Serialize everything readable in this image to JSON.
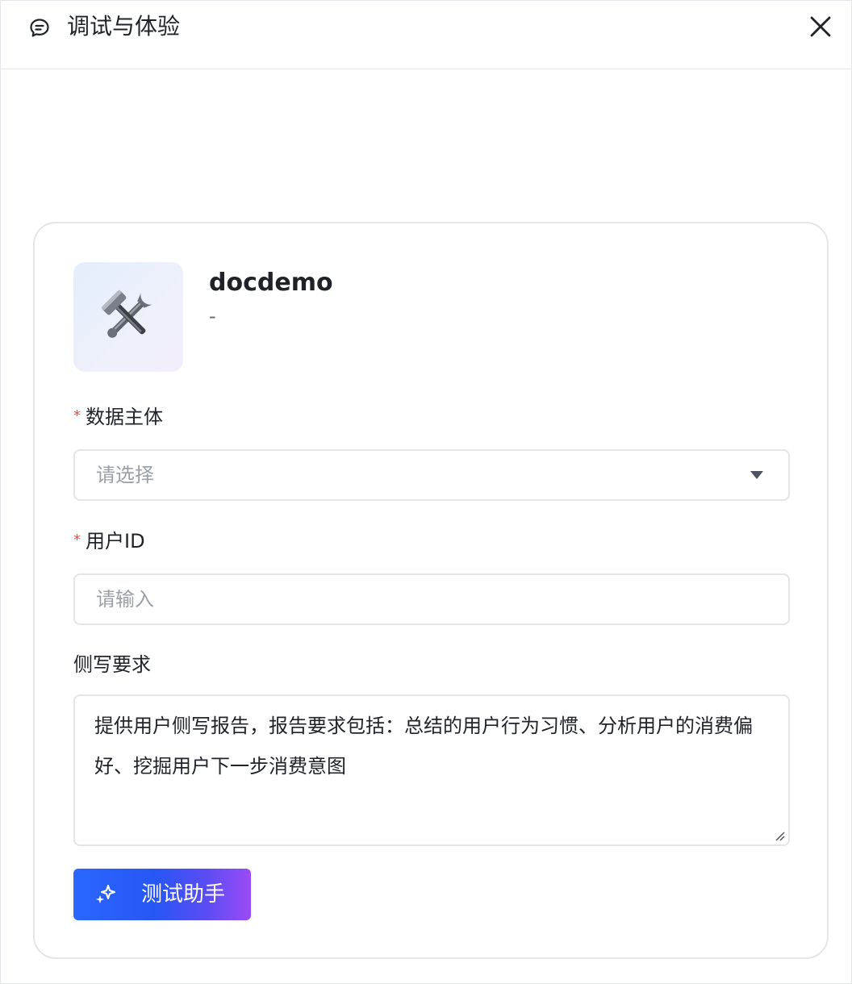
{
  "header": {
    "title": "调试与体验",
    "icon": "chat-bubble-icon",
    "close_icon": "close-icon"
  },
  "app": {
    "name": "docdemo",
    "description": "-",
    "avatar_icon": "hammer-wrench-icon"
  },
  "form": {
    "subject": {
      "label": "数据主体",
      "required_mark": "*",
      "placeholder": "请选择"
    },
    "user_id": {
      "label": "用户ID",
      "required_mark": "*",
      "placeholder": "请输入"
    },
    "requirements": {
      "label": "侧写要求",
      "value": "提供用户侧写报告，报告要求包括：总结的用户行为习惯、分析用户的消费偏好、挖掘用户下一步消费意图"
    }
  },
  "actions": {
    "test_label": "测试助手",
    "test_icon": "sparkle-icon"
  },
  "colors": {
    "accent": "#2b66ff",
    "accent_end": "#9b4bf5",
    "required": "#f54a45",
    "border": "#e3e5e8"
  }
}
